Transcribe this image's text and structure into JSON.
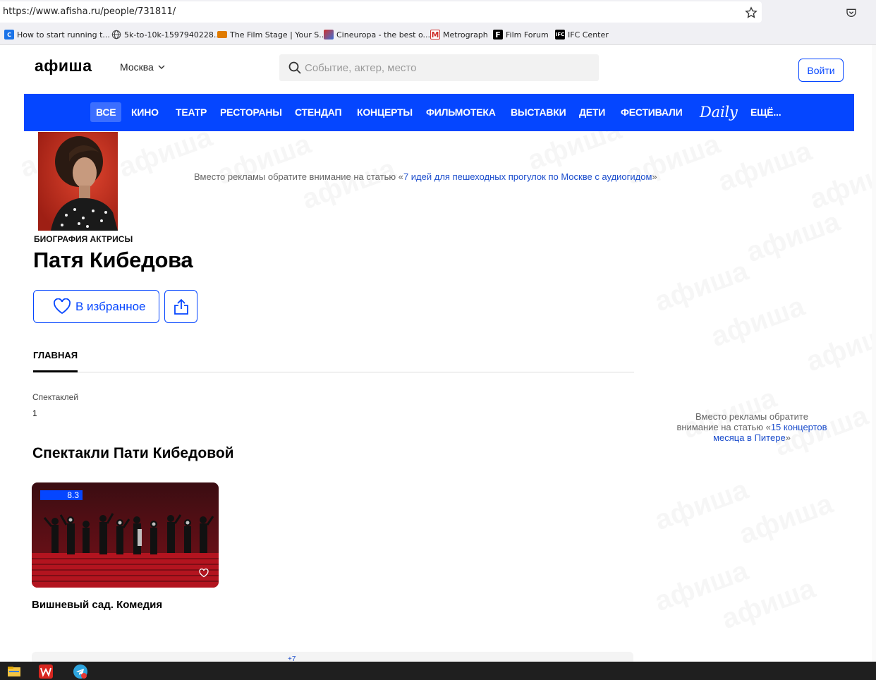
{
  "browser": {
    "url": "https://www.afisha.ru/people/731811/",
    "bookmarks": [
      {
        "label": "How to start running t...",
        "icon": "couch-to-5k-icon",
        "color": "#1a73e8"
      },
      {
        "label": "5k-to-10k-1597940228....",
        "icon": "globe-icon",
        "color": "#444444"
      },
      {
        "label": "The Film Stage | Your S...",
        "icon": "film-stage-icon",
        "color": "#e07b00"
      },
      {
        "label": "Cineuropa - the best o...",
        "icon": "cineuropa-icon",
        "color": "#d0312d"
      },
      {
        "label": "Metrograph",
        "icon": "metrograph-icon",
        "color": "#d0312d"
      },
      {
        "label": "Film Forum",
        "icon": "film-forum-icon",
        "color": "#000000"
      },
      {
        "label": "IFC Center",
        "icon": "ifc-center-icon",
        "color": "#000000"
      }
    ]
  },
  "header": {
    "logo": "афиша",
    "city": "Москва",
    "search_placeholder": "Событие, актер, место",
    "login_label": "Войти"
  },
  "nav": {
    "items": [
      "ВСЕ",
      "КИНО",
      "ТЕАТР",
      "РЕСТОРАНЫ",
      "СТЕНДАП",
      "КОНЦЕРТЫ",
      "ФИЛЬМОТЕКА",
      "ВЫСТАВКИ",
      "ДЕТИ",
      "ФЕСТИВАЛИ",
      "Daily",
      "ЕЩЁ..."
    ],
    "active": "ВСЕ",
    "color": "#0546ff"
  },
  "ads": {
    "top_prefix": "Вместо рекламы обратите внимание на статью «",
    "top_link": "7 идей для пешеходных прогулок по Москве с аудиогидом",
    "top_suffix": "»",
    "side_prefix": "Вместо рекламы обратите внимание на статью «",
    "side_link": "15 концертов месяца в Питере",
    "side_suffix": "»"
  },
  "person": {
    "eyebrow": "БИОГРАФИЯ АКТРИСЫ",
    "name": "Патя Кибедова",
    "favorite_label": "В избранное"
  },
  "tabs": {
    "main": "ГЛАВНАЯ"
  },
  "stats": {
    "label": "Спектаклей",
    "value": "1"
  },
  "section": {
    "title": "Спектакли Пати Кибедовой",
    "cards": [
      {
        "title": "Вишневый сад. Комедия",
        "rating": "8.3"
      }
    ],
    "more_text": "+7"
  },
  "watermark": "афиша"
}
